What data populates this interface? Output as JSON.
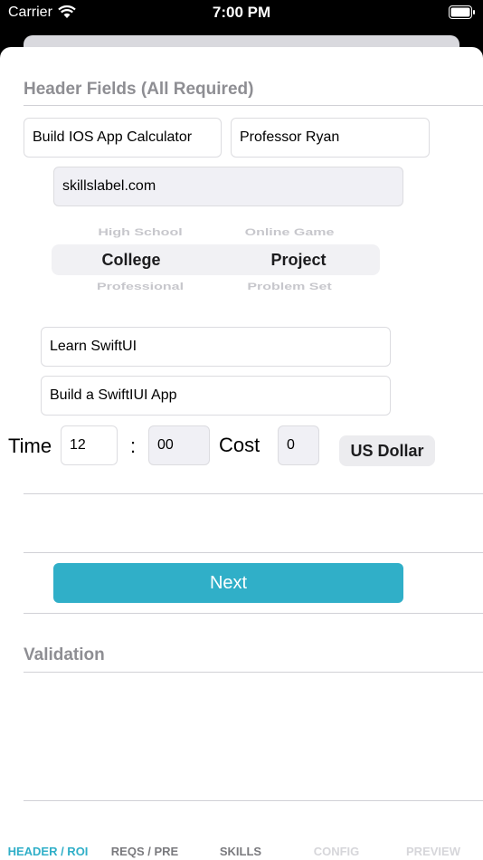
{
  "status_bar": {
    "carrier": "Carrier",
    "time": "7:00 PM"
  },
  "header_section": {
    "title": "Header Fields (All Required)",
    "course_name": "Build IOS App Calculator",
    "instructor": "Professor Ryan",
    "website": "skillslabel.com"
  },
  "pickers": {
    "level": {
      "above": "High School",
      "selected": "College",
      "below": "Professional"
    },
    "type": {
      "above": "Online Game",
      "selected": "Project",
      "below": "Problem Set"
    }
  },
  "details": {
    "topic": "Learn SwiftUI",
    "goal": "Build a SwiftIUI App"
  },
  "time_cost": {
    "time_label": "Time",
    "hours": "12",
    "separator": ":",
    "minutes": "00",
    "cost_label": "Cost",
    "cost_value": "0",
    "currency": "US Dollar"
  },
  "actions": {
    "next_label": "Next"
  },
  "validation": {
    "title": "Validation"
  },
  "tabs": [
    {
      "label": "HEADER / ROI",
      "state": "active"
    },
    {
      "label": "REQS / PRE",
      "state": "normal"
    },
    {
      "label": "SKILLS",
      "state": "normal"
    },
    {
      "label": "CONFIG",
      "state": "disabled"
    },
    {
      "label": "PREVIEW",
      "state": "disabled"
    }
  ],
  "colors": {
    "accent": "#30afc8",
    "section_title": "#8e8e93",
    "disabled_tab": "#d6d6da"
  }
}
